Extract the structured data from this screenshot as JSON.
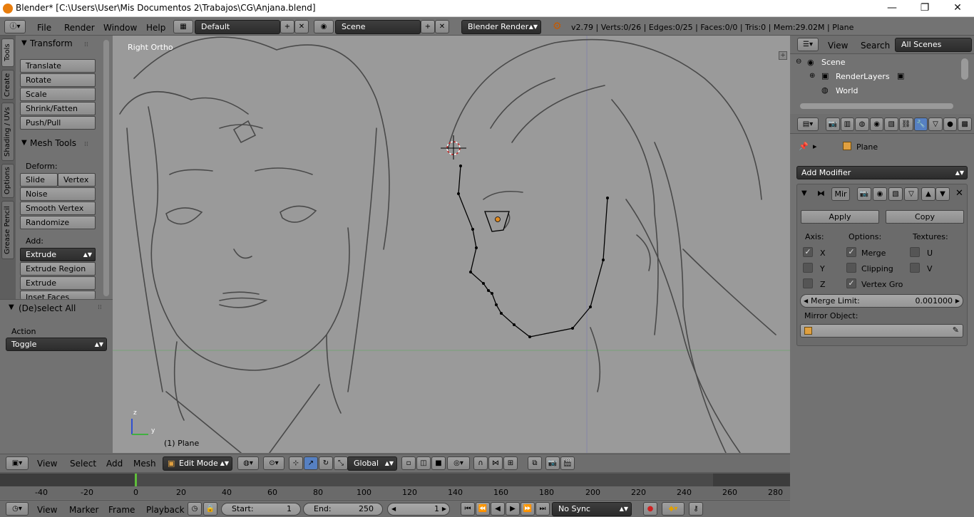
{
  "window": {
    "title": "Blender* [C:\\Users\\User\\Mis Documentos 2\\Trabajos\\CG\\Anjana.blend]",
    "controls": [
      "—",
      "❐",
      "✕"
    ]
  },
  "info_header": {
    "menus": [
      "File",
      "Render",
      "Window",
      "Help"
    ],
    "layout": "Default",
    "scene": "Scene",
    "engine": "Blender Render",
    "stats": "v2.79 | Verts:0/26 | Edges:0/25 | Faces:0/0 | Tris:0 | Mem:29.02M | Plane"
  },
  "toolshelf": {
    "tabs": [
      "Tools",
      "Create",
      "Shading / UVs",
      "Options",
      "Grease Pencil"
    ],
    "transform_title": "Transform",
    "transform_buttons": [
      "Translate",
      "Rotate",
      "Scale",
      "Shrink/Fatten",
      "Push/Pull"
    ],
    "mesh_tools_title": "Mesh Tools",
    "deform_label": "Deform:",
    "slide_edge": "Slide Ed",
    "vertex": "Vertex",
    "deform_buttons": [
      "Noise",
      "Smooth Vertex",
      "Randomize"
    ],
    "add_label": "Add:",
    "extrude": "Extrude",
    "add_buttons": [
      "Extrude Region",
      "Extrude Individual",
      "Inset Faces"
    ]
  },
  "operator": {
    "title": "(De)select All",
    "action_label": "Action",
    "action_value": "Toggle"
  },
  "viewport": {
    "view_name": "Right Ortho",
    "object_label": "(1) Plane",
    "axis_z": "z",
    "axis_y": "y"
  },
  "outliner": {
    "menus": [
      "View",
      "Search"
    ],
    "scope": "All Scenes",
    "items": [
      "Scene",
      "RenderLayers",
      "World"
    ]
  },
  "properties": {
    "object_name": "Plane",
    "add_modifier": "Add Modifier",
    "modifier_name": "Mir",
    "apply": "Apply",
    "copy": "Copy",
    "axis_label": "Axis:",
    "options_label": "Options:",
    "textures_label": "Textures:",
    "axes": [
      {
        "label": "X",
        "checked": true
      },
      {
        "label": "Y",
        "checked": false
      },
      {
        "label": "Z",
        "checked": false
      }
    ],
    "options": [
      {
        "label": "Merge",
        "checked": true
      },
      {
        "label": "Clipping",
        "checked": false
      },
      {
        "label": "Vertex Gro",
        "checked": true
      }
    ],
    "textures": [
      {
        "label": "U",
        "checked": false
      },
      {
        "label": "V",
        "checked": false
      }
    ],
    "merge_limit_label": "Merge Limit:",
    "merge_limit_value": "0.001000",
    "mirror_object_label": "Mirror Object:"
  },
  "view3d_header": {
    "menus": [
      "View",
      "Select",
      "Add",
      "Mesh"
    ],
    "mode": "Edit Mode",
    "orientation": "Global"
  },
  "timeline": {
    "ticks": [
      "-40",
      "-20",
      "0",
      "20",
      "40",
      "60",
      "80",
      "100",
      "120",
      "140",
      "160",
      "180",
      "200",
      "220",
      "240",
      "260",
      "280"
    ],
    "menus": [
      "View",
      "Marker",
      "Frame",
      "Playback"
    ],
    "start_label": "Start:",
    "start_value": "1",
    "end_label": "End:",
    "end_value": "250",
    "current_frame": "1",
    "sync": "No Sync"
  }
}
